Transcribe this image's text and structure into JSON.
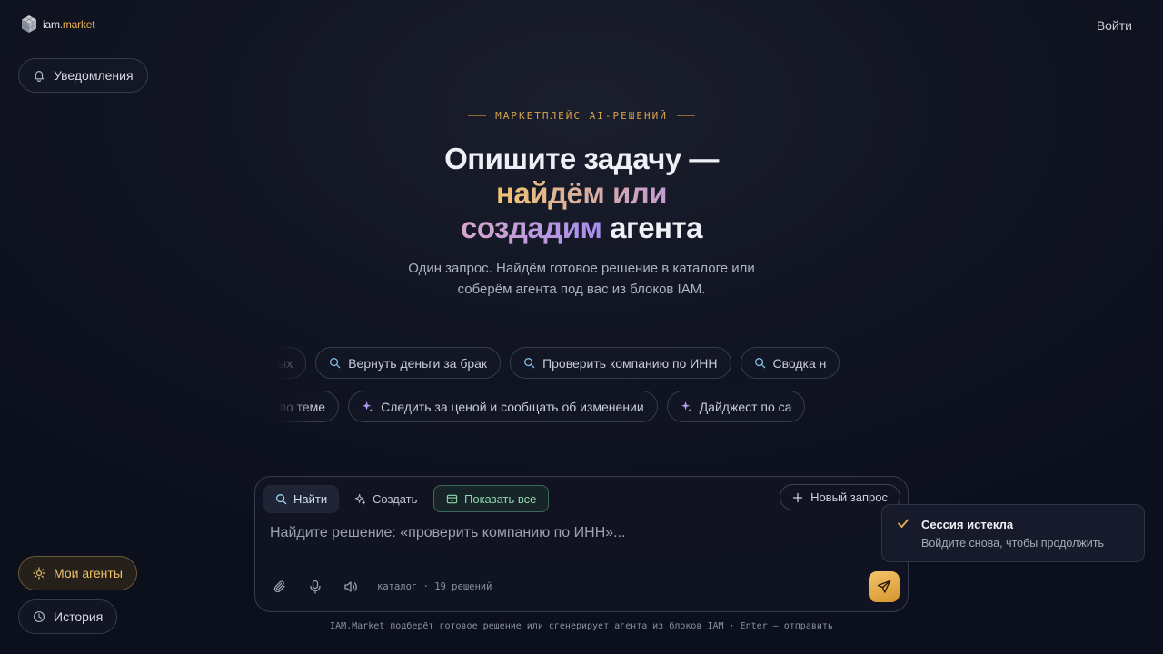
{
  "header": {
    "logo_text_main": "iam",
    "logo_text_dot": ".",
    "logo_text_accent": "market",
    "login_label": "Войти"
  },
  "sidebar": {
    "notifications_label": "Уведомления",
    "my_agents_label": "Мои агенты",
    "history_label": "История"
  },
  "hero": {
    "eyebrow": "МАРКЕТПЛЕЙС AI-РЕШЕНИЙ",
    "title_line1": "Опишите задачу —",
    "title_line2": "найдём или",
    "title_line3_accent": "создадим",
    "title_line3_rest": " агента",
    "subtitle_line1": "Один запрос. Найдём готовое решение в каталоге или",
    "subtitle_line2": "соберём агента под вас из блоков IAM."
  },
  "suggestions": {
    "row1": [
      {
        "label": "на выходных",
        "icon": "search-icon"
      },
      {
        "label": "Вернуть деньги за брак",
        "icon": "search-icon"
      },
      {
        "label": "Проверить компанию по ИНН",
        "icon": "search-icon"
      },
      {
        "label": "Сводка н",
        "icon": "search-icon"
      }
    ],
    "row2": [
      {
        "label": "сводка новостей по теме",
        "icon": "sparkle-icon"
      },
      {
        "label": "Следить за ценой и сообщать об изменении",
        "icon": "sparkle-icon"
      },
      {
        "label": "Дайджест по са",
        "icon": "sparkle-icon"
      }
    ]
  },
  "composer": {
    "tab_find": "Найти",
    "tab_create": "Создать",
    "tab_show_all": "Показать все",
    "new_request": "Новый запрос",
    "input_placeholder": "Найдите решение: «проверить компанию по ИНН»...",
    "input_value": "",
    "catalog_info": "каталог · 19 решений",
    "hint": "IAM.Market подберёт готовое решение или сгенерирует агента из блоков IAM · Enter — отправить"
  },
  "toast": {
    "title": "Сессия истекла",
    "description": "Войдите снова, чтобы продолжить"
  },
  "colors": {
    "accent_gold": "#e8b04d",
    "accent_purple": "#a68ef0",
    "success_green": "#8fd6ae",
    "background": "#0c0f1c"
  }
}
